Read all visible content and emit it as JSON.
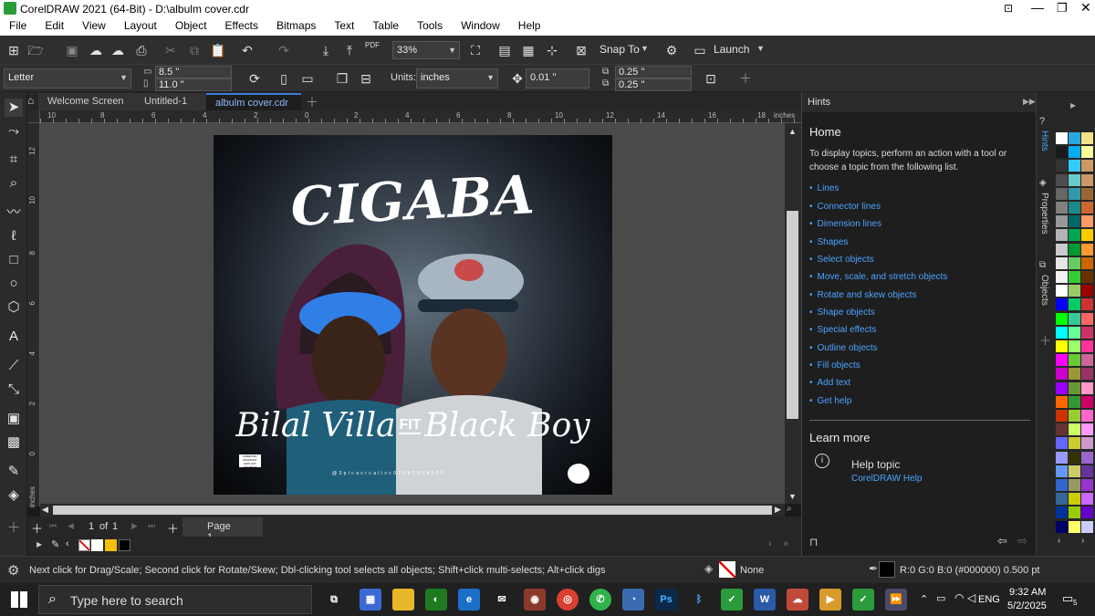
{
  "window": {
    "title": "CorelDRAW 2021 (64-Bit) - D:\\albulm cover.cdr"
  },
  "menu": [
    "File",
    "Edit",
    "View",
    "Layout",
    "Object",
    "Effects",
    "Bitmaps",
    "Text",
    "Table",
    "Tools",
    "Window",
    "Help"
  ],
  "toolbar": {
    "zoom": "33%",
    "snap_to": "Snap To",
    "launch": "Launch",
    "pdf": "PDF"
  },
  "property_bar": {
    "page_size": "Letter",
    "width": "8.5 \"",
    "height": "11.0 \"",
    "units_label": "Units:",
    "units": "inches",
    "nudge": "0.01 \"",
    "dup_x": "0.25 \"",
    "dup_y": "0.25 \""
  },
  "tabs": [
    "Welcome Screen",
    "Untitled-1",
    "albulm cover.cdr"
  ],
  "ruler": {
    "h_ticks": [
      "10",
      "8",
      "6",
      "4",
      "2",
      "0",
      "2",
      "4",
      "6",
      "8",
      "10",
      "12",
      "14",
      "16",
      "18"
    ],
    "unit": "inches",
    "v_ticks": [
      "12",
      "10",
      "8",
      "6",
      "4",
      "2",
      "0"
    ]
  },
  "artwork": {
    "title": "CIGABA",
    "artist_line_left": "Bilal Villa",
    "artist_line_fit": "FIT",
    "artist_line_right": "Black Boy",
    "contact": "@ 3 p l c a c r c a l i v c 0 7 0 8 7 0 6 9 3 6 6",
    "advisory": "PARENTAL ADVISORY EXPLICIT CONTENT"
  },
  "page_nav": {
    "current": "1",
    "of": "of",
    "total": "1",
    "page_tab": "Page 1"
  },
  "hints": {
    "header": "Hints",
    "home": "Home",
    "intro": "To display topics, perform an action with a tool or choose a topic from the following list.",
    "topics": [
      "Lines",
      "Connector lines",
      "Dimension lines",
      "Shapes",
      "Select objects",
      "Move, scale, and stretch objects",
      "Rotate and skew objects",
      "Shape objects",
      "Special effects",
      "Outline objects",
      "Fill objects",
      "Add text",
      "Get help"
    ],
    "learn_more": "Learn more",
    "help_topic": "Help topic",
    "help_link": "CorelDRAW Help"
  },
  "dock_tabs": [
    "Hints",
    "Properties",
    "Objects"
  ],
  "palette_colors": [
    [
      "#ffffff",
      "#2aa7e0",
      "#f5e08a"
    ],
    [
      "#1a1a1a",
      "#00aeef",
      "#ffff99"
    ],
    [
      "#333333",
      "#33ccff",
      "#cc9966"
    ],
    [
      "#4d4d4d",
      "#66cccc",
      "#cc9966"
    ],
    [
      "#666666",
      "#3399aa",
      "#996633"
    ],
    [
      "#808080",
      "#1a8a8a",
      "#cc6633"
    ],
    [
      "#999999",
      "#006666",
      "#ff9966"
    ],
    [
      "#b3b3b3",
      "#00a651",
      "#ffcc00"
    ],
    [
      "#cccccc",
      "#009933",
      "#ff9933"
    ],
    [
      "#e6e6e6",
      "#66cc66",
      "#cc6600"
    ],
    [
      "#f2f2f2",
      "#33cc33",
      "#663300"
    ],
    [
      "#ffffff",
      "#99cc66",
      "#990000"
    ],
    [
      "#0000ff",
      "#00cc66",
      "#cc3333"
    ],
    [
      "#00ff00",
      "#33cc99",
      "#ff6666"
    ],
    [
      "#00ffff",
      "#66ff99",
      "#cc3366"
    ],
    [
      "#ffff00",
      "#99ff66",
      "#ff3399"
    ],
    [
      "#ff00ff",
      "#66cc33",
      "#cc6699"
    ],
    [
      "#cc00cc",
      "#999933",
      "#993366"
    ],
    [
      "#9900ff",
      "#669933",
      "#ff99cc"
    ],
    [
      "#ff6600",
      "#339933",
      "#cc0066"
    ],
    [
      "#cc3300",
      "#99cc33",
      "#ff66cc"
    ],
    [
      "#663333",
      "#ccff66",
      "#ff99ff"
    ],
    [
      "#6666ff",
      "#cccc33",
      "#cc99cc"
    ],
    [
      "#9999ff",
      "#333300",
      "#9966cc"
    ],
    [
      "#6699ff",
      "#cccc66",
      "#663399"
    ],
    [
      "#3366cc",
      "#999966",
      "#9933cc"
    ],
    [
      "#336699",
      "#cccc00",
      "#cc66ff"
    ],
    [
      "#003399",
      "#99cc00",
      "#6600cc"
    ],
    [
      "#000066",
      "#ffff66",
      "#ccccff"
    ]
  ],
  "status": {
    "hint": "Next click for Drag/Scale; Second click for Rotate/Skew; Dbl-clicking tool selects all objects; Shift+click multi-selects; Alt+click digs",
    "fill": "None",
    "outline": "R:0 G:0 B:0 (#000000)  0.500 pt"
  },
  "taskbar": {
    "search_placeholder": "Type here to search",
    "time": "9:32 AM",
    "date": "5/2/2025",
    "lang": "ENG",
    "notifications": "5"
  }
}
